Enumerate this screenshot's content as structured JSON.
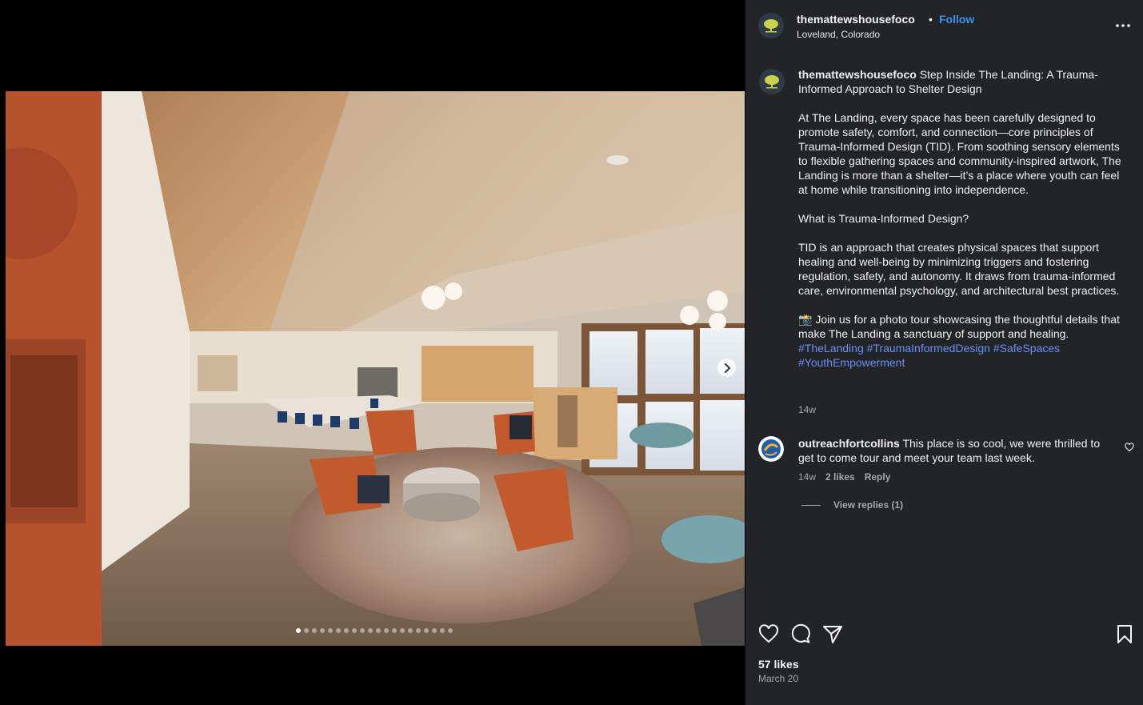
{
  "post": {
    "username": "themattewshousefoco",
    "follow_label": "Follow",
    "separator": "•",
    "location": "Loveland, Colorado",
    "image_alt": "Interior lounge of The Landing shelter with orange rocking chairs, round rug, long dining tables and large windows",
    "carousel_total": 20,
    "carousel_index": 1
  },
  "caption": {
    "username": "themattewshousefoco",
    "title": "Step Inside The Landing: A Trauma-Informed Approach to Shelter Design",
    "para1": "At The Landing, every space has been carefully designed to promote safety, comfort, and connection—core principles of Trauma-Informed Design (TID). From soothing sensory elements to flexible gathering spaces and community-inspired artwork, The Landing is more than a shelter—it’s a place where youth can feel at home while transitioning into independence.",
    "para2": "What is Trauma-Informed Design?",
    "para3": "TID is an approach that creates physical spaces that support healing and well-being by minimizing triggers and fostering regulation, safety, and autonomy. It draws from trauma-informed care, environmental psychology, and architectural best practices.",
    "para4": "📸 Join us for a photo tour showcasing the thoughtful details that make The Landing a sanctuary of support and healing.",
    "hashtags": [
      "#TheLanding",
      "#TraumaInformedDesign",
      "#SafeSpaces",
      "#YouthEmpowerment"
    ],
    "time": "14w"
  },
  "comment": {
    "username": "outreachfortcollins",
    "text": "This place is so cool, we were thrilled to get to come tour and meet your team last week.",
    "time": "14w",
    "likes": "2 likes",
    "reply_label": "Reply",
    "view_replies": "View replies (1)"
  },
  "footer": {
    "likes": "57 likes",
    "date": "March 20"
  },
  "icons": {
    "like": "heart-icon",
    "comment": "comment-bubble-icon",
    "share": "paper-plane-icon",
    "save": "bookmark-icon",
    "more": "more-dots-icon",
    "next": "chevron-right-icon"
  },
  "colors": {
    "panel_bg": "#232428",
    "link": "#3d8ff0",
    "hashtag": "#6a8ff5",
    "muted": "#a8a8a8"
  }
}
